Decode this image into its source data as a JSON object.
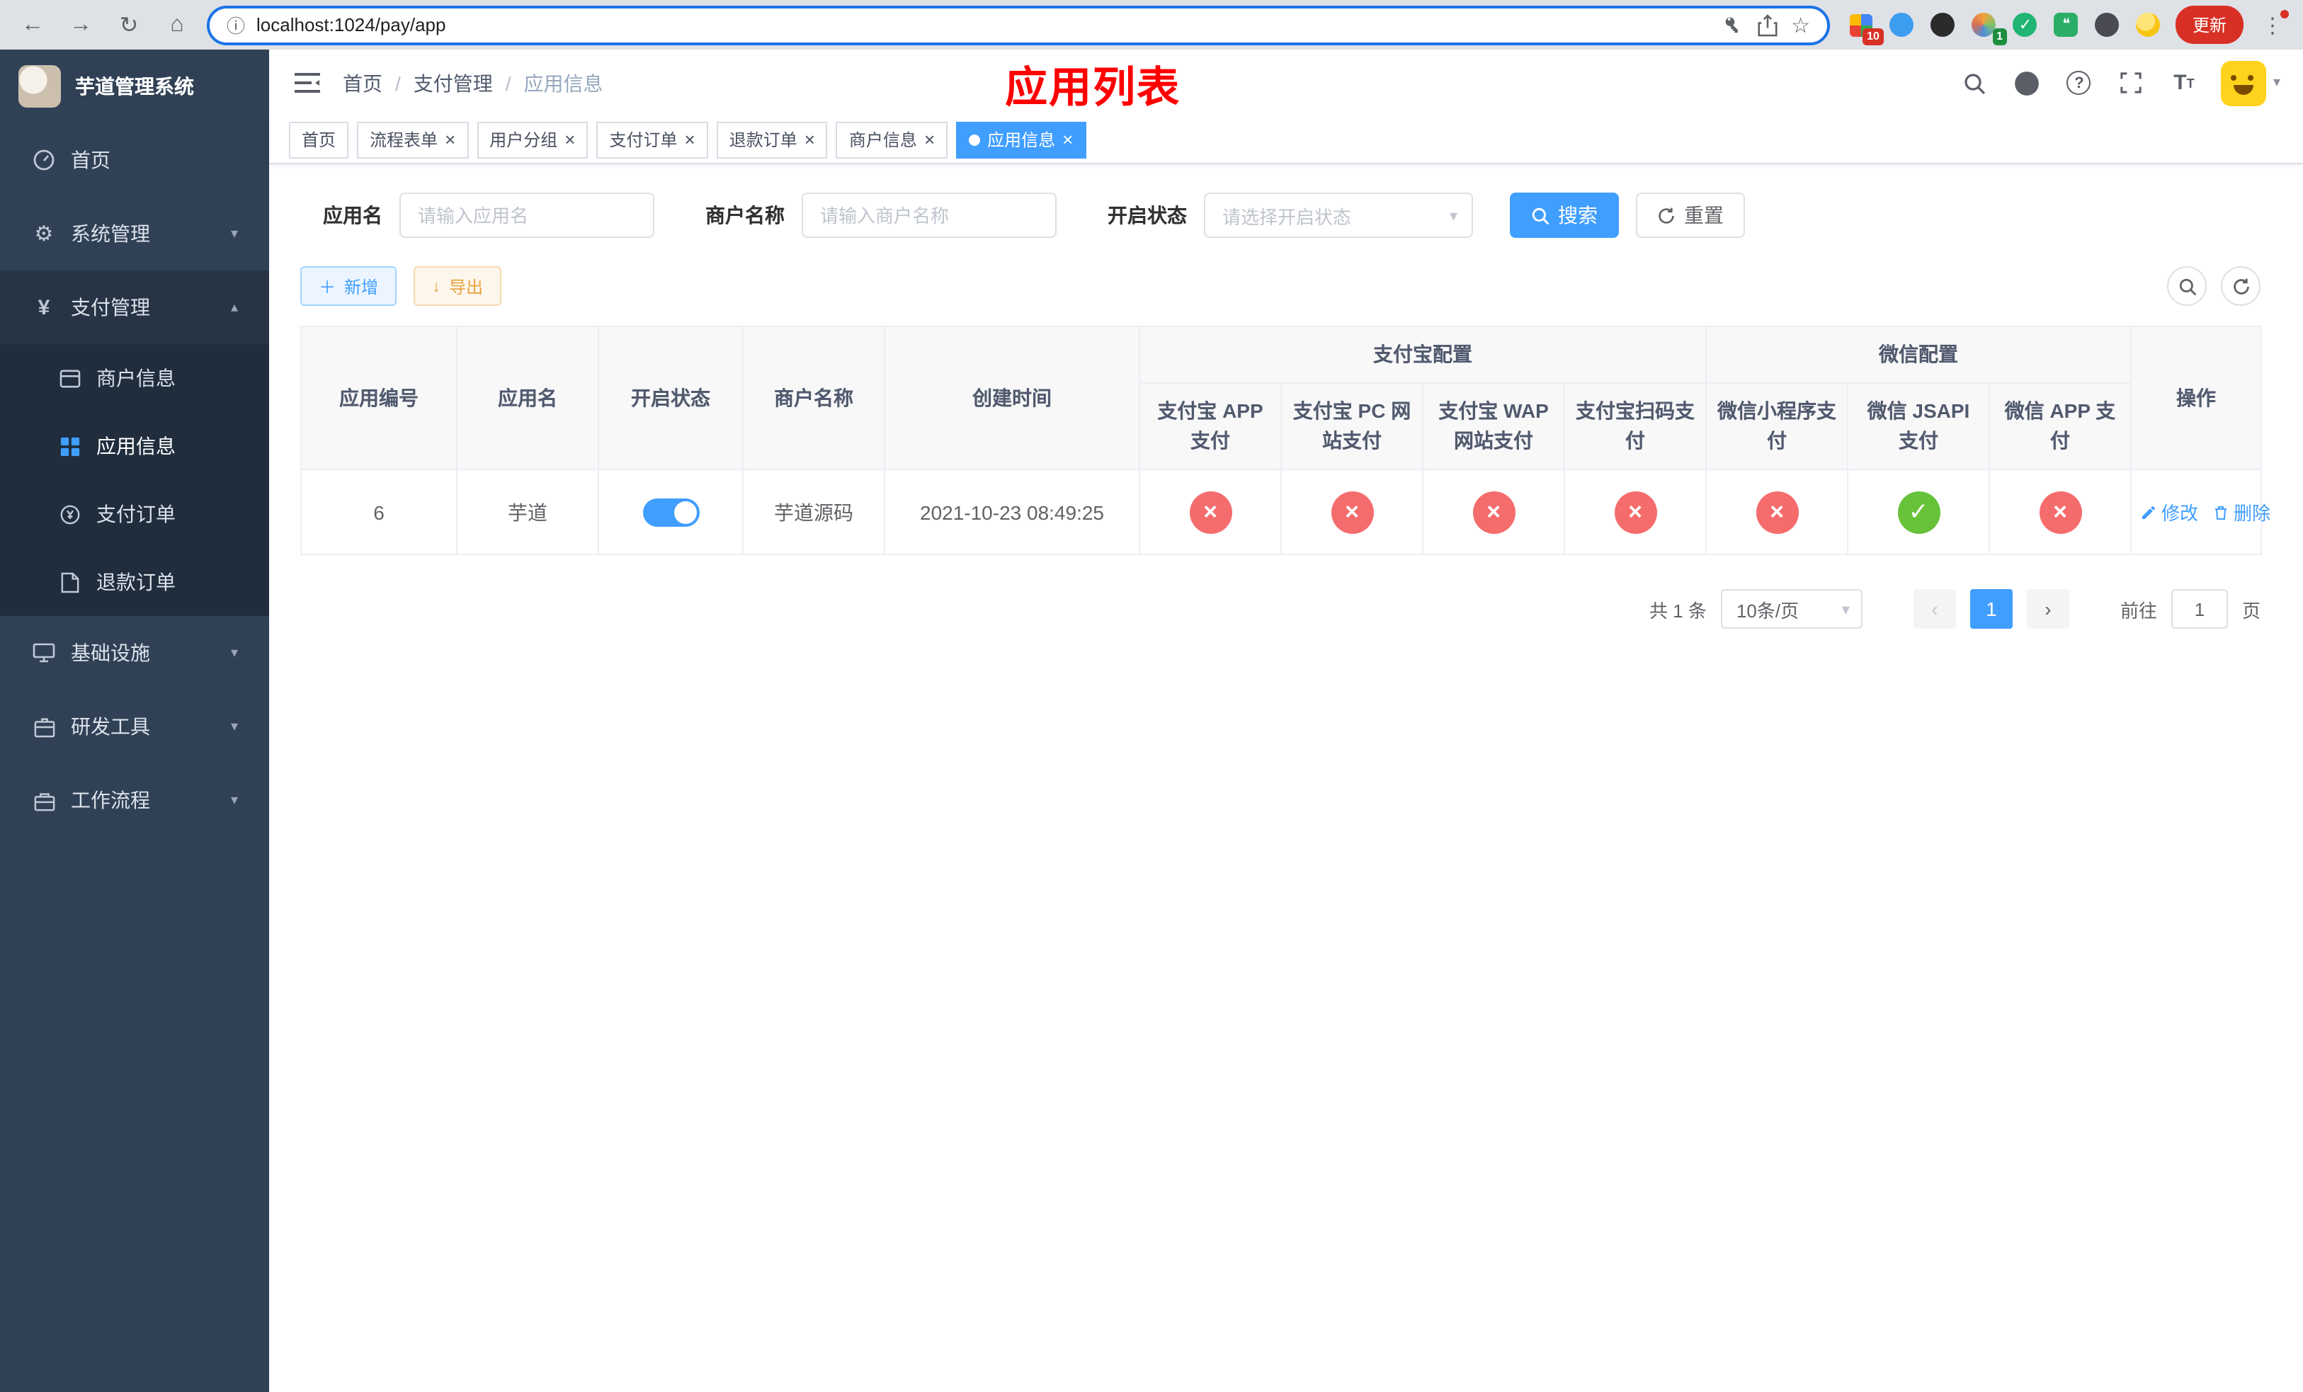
{
  "browser": {
    "url": "localhost:1024/pay/app",
    "update_label": "更新",
    "extensions_badge": "10",
    "profile_badge": "1"
  },
  "sidebar": {
    "app_title": "芋道管理系统",
    "menu_home": "首页",
    "menu_system": "系统管理",
    "menu_pay": "支付管理",
    "menu_infra": "基础设施",
    "menu_dev": "研发工具",
    "menu_flow": "工作流程",
    "submenu": {
      "merchant": "商户信息",
      "app": "应用信息",
      "order": "支付订单",
      "refund": "退款订单"
    }
  },
  "header": {
    "breadcrumb_home": "首页",
    "breadcrumb_pay": "支付管理",
    "breadcrumb_current": "应用信息",
    "page_title": "应用列表"
  },
  "tabs": [
    {
      "label": "首页"
    },
    {
      "label": "流程表单"
    },
    {
      "label": "用户分组"
    },
    {
      "label": "支付订单"
    },
    {
      "label": "退款订单"
    },
    {
      "label": "商户信息"
    },
    {
      "label": "应用信息"
    }
  ],
  "filters": {
    "app_name_label": "应用名",
    "app_name_placeholder": "请输入应用名",
    "merchant_label": "商户名称",
    "merchant_placeholder": "请输入商户名称",
    "status_label": "开启状态",
    "status_placeholder": "请选择开启状态",
    "search_button": "搜索",
    "reset_button": "重置"
  },
  "toolbar": {
    "add_label": "新增",
    "export_label": "导出"
  },
  "table": {
    "headers": {
      "app_id": "应用编号",
      "app_name": "应用名",
      "status": "开启状态",
      "merchant": "商户名称",
      "created": "创建时间",
      "alipay_group": "支付宝配置",
      "wechat_group": "微信配置",
      "actions": "操作",
      "alipay_cols": [
        "支付宝 APP 支付",
        "支付宝 PC 网站支付",
        "支付宝 WAP 网站支付",
        "支付宝扫码支付"
      ],
      "wechat_cols": [
        "微信小程序支付",
        "微信 JSAPI 支付",
        "微信 APP 支付"
      ]
    },
    "rows": [
      {
        "app_id": "6",
        "app_name": "芋道",
        "status_on": true,
        "merchant": "芋道源码",
        "created": "2021-10-23 08:49:25",
        "channels": [
          "no",
          "no",
          "no",
          "no",
          "no",
          "yes",
          "no"
        ],
        "edit_label": "修改",
        "delete_label": "删除"
      }
    ]
  },
  "pagination": {
    "total_text": "共 1 条",
    "page_size": "10条/页",
    "current_page": "1",
    "goto_prefix": "前往",
    "goto_value": "1",
    "goto_suffix": "页"
  }
}
